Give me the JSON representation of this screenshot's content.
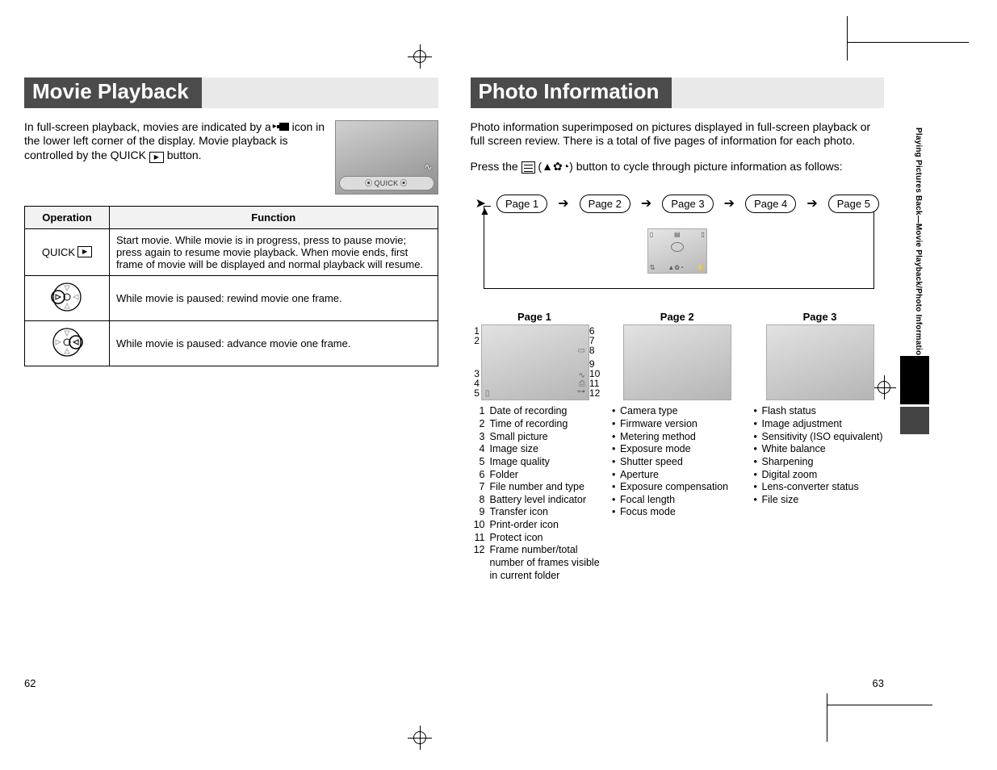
{
  "left": {
    "heading": "Movie Playback",
    "intro": "In full-screen playback, movies are indicated by a  icon in the lower left corner of the display. Movie playback is controlled by the QUICK  button.",
    "thumb_quick": "QUICK",
    "table": {
      "col1": "Operation",
      "col2": "Function",
      "rows": [
        {
          "op": "QUICK ",
          "fn": "Start movie. While movie is in progress, press to pause movie; press again to resume movie playback. When movie ends, first frame of movie will be displayed and normal playback will resume."
        },
        {
          "op": "left",
          "fn": "While movie is paused: rewind movie one frame."
        },
        {
          "op": "right",
          "fn": "While movie is paused: advance movie one frame."
        }
      ]
    },
    "page_num": "62"
  },
  "right": {
    "heading": "Photo Information",
    "intro1": "Photo information superimposed on pictures displayed in full-screen playback or full screen review. There is a total of five pages of information for each photo.",
    "intro2a": "Press the ",
    "intro2b": " button to cycle through picture information as follows:",
    "flow": {
      "p1": "Page 1",
      "p2": "Page 2",
      "p3": "Page 3",
      "p4": "Page 4",
      "p5": "Page 5"
    },
    "triple": {
      "p1": "Page 1",
      "p2": "Page 2",
      "p3": "Page 3"
    },
    "legend_num": [
      "Date of recording",
      "Time of recording",
      "Small picture",
      "Image size",
      "Image quality",
      "Folder",
      "File number and type",
      "Battery level indicator",
      "Transfer icon",
      "Print-order icon",
      "Protect icon",
      "Frame number/total number of frames visible in current folder"
    ],
    "legend_p2": [
      "Camera type",
      "Firmware version",
      "Metering method",
      "Exposure mode",
      "Shutter speed",
      "Aperture",
      "Exposure compensation",
      "Focal length",
      "Focus mode"
    ],
    "legend_p3": [
      "Flash status",
      "Image adjustment",
      "Sensitivity (ISO equivalent)",
      "White balance",
      "Sharpening",
      "Digital zoom",
      "Lens-converter status",
      "File size"
    ],
    "side_tab": "Playing Pictures Back—Movie Playback/Photo Information",
    "page_num": "63"
  }
}
